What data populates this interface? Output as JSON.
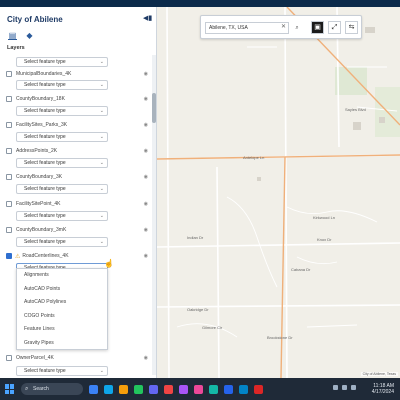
{
  "panel": {
    "title": "City of Abilene",
    "tabs": [
      "layers-tab",
      "basemap-tab"
    ],
    "section_label": "Layers"
  },
  "layers": [
    {
      "name": "",
      "checked": false,
      "select": "Select feature type"
    },
    {
      "name": "MunicipalBoundaries_4K",
      "checked": false,
      "select": "Select feature type"
    },
    {
      "name": "CountyBoundary_18K",
      "checked": false,
      "select": "Select feature type"
    },
    {
      "name": "FacilitySites_Parks_3K",
      "checked": false,
      "select": "Select feature type"
    },
    {
      "name": "AddressPoints_2K",
      "checked": false,
      "select": "Select feature type"
    },
    {
      "name": "CountyBoundary_3K",
      "checked": false,
      "select": "Select feature type"
    },
    {
      "name": "FacilitySitePoint_4K",
      "checked": false,
      "select": "Select feature type"
    },
    {
      "name": "CountyBoundary_3mK",
      "checked": false,
      "select": "Select feature type"
    },
    {
      "name": "RoadCenterlines_4K",
      "checked": true,
      "select": "Select feature type"
    }
  ],
  "dropdown": {
    "options": [
      "Alignments",
      "AutoCAD Points",
      "AutoCAD Polylines",
      "COGO Points",
      "Feature Lines",
      "Gravity Pipes"
    ]
  },
  "trailing_layer": {
    "name": "OwnerParcel_4K",
    "select": "Select feature type"
  },
  "search": {
    "value": "Abilene, TX, USA"
  },
  "map": {
    "streets": [
      "Antelope Ln",
      "Kirkwood Ln",
      "Cabana Dr",
      "Oakridge Dr",
      "Gilmore Cir",
      "Sayles Blvd",
      "Brookstone Dr",
      "Knox Dr",
      "Indian Dr"
    ],
    "attribution": "City of Abilene, Texas"
  },
  "taskbar": {
    "search_label": "Search",
    "time": "11:18 AM",
    "date": "4/17/2024"
  },
  "colors": {
    "accent": "#2f6fcf",
    "map_bg": "#f1efe8",
    "highway": "#f0b07a",
    "taskbar": "#1f2a38"
  }
}
